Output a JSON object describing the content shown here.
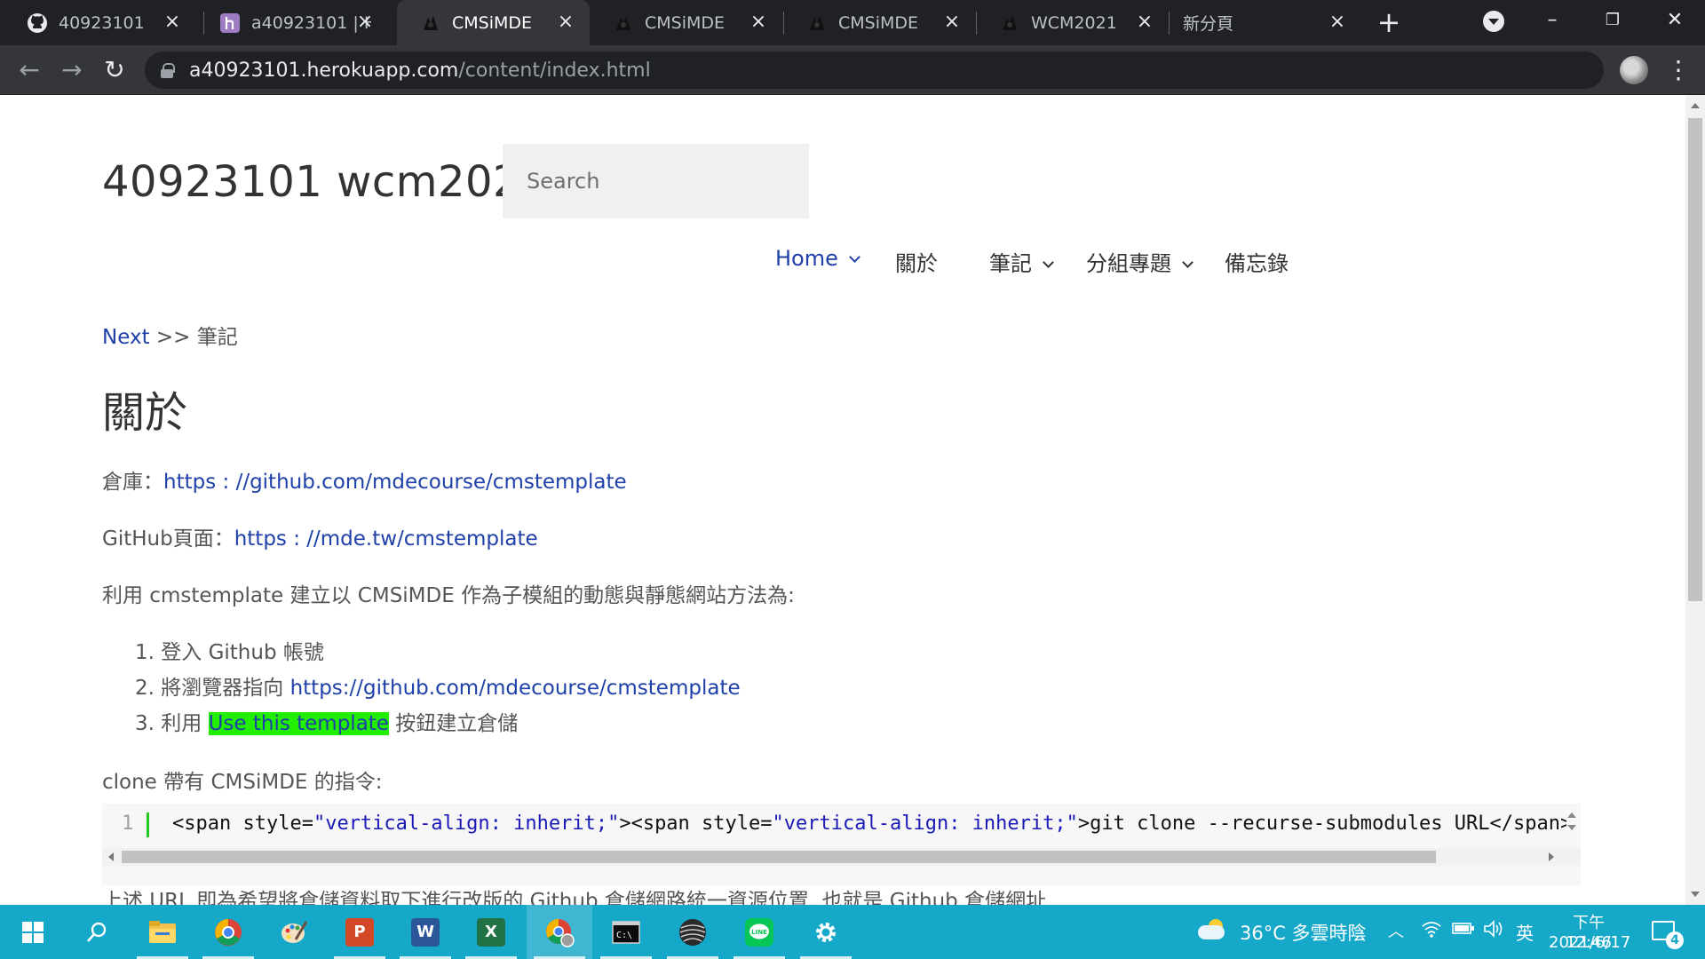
{
  "browser": {
    "tabs": [
      {
        "title": "40923101",
        "favicon": "github-icon",
        "active": false
      },
      {
        "title": "a40923101 | H",
        "favicon": "heroku-icon",
        "active": false
      },
      {
        "title": "CMSiMDE",
        "favicon": "cmsimde-icon",
        "active": true
      },
      {
        "title": "CMSiMDE",
        "favicon": "cmsimde-icon",
        "active": false
      },
      {
        "title": "CMSiMDE",
        "favicon": "cmsimde-icon",
        "active": false
      },
      {
        "title": "WCM2021",
        "favicon": "cmsimde-icon",
        "active": false
      },
      {
        "title": "新分頁",
        "favicon": "",
        "active": false
      }
    ],
    "url_host": "a40923101.herokuapp.com",
    "url_path": "/content/index.html"
  },
  "site": {
    "title": "40923101 wcm2021",
    "search_placeholder": "Search",
    "menu": [
      {
        "label": "Home",
        "has_dropdown": true,
        "current": true
      },
      {
        "label": "關於",
        "has_dropdown": false,
        "current": false
      },
      {
        "label": "筆記",
        "has_dropdown": true,
        "current": false
      },
      {
        "label": "分組專題",
        "has_dropdown": true,
        "current": false
      },
      {
        "label": "備忘錄",
        "has_dropdown": false,
        "current": false
      }
    ]
  },
  "content": {
    "breadcrumb_link": "Next",
    "breadcrumb_rest": " >> 筆記",
    "heading": "關於",
    "repo_label": "倉庫：",
    "repo_link": "https : //github.com/mdecourse/cmstemplate",
    "ghpage_label": "GitHub頁面：",
    "ghpage_link": "https : //mde.tw/cmstemplate",
    "intro": "利用 cmstemplate 建立以 CMSiMDE 作為子模組的動態與靜態網站方法為:",
    "steps": {
      "s1": "1. 登入 Github 帳號",
      "s2_prefix": "2. 將瀏覽器指向 ",
      "s2_link": "https://github.com/mdecourse/cmstemplate",
      "s3_prefix": "3. 利用 ",
      "s3_highlight": "Use this template",
      "s3_suffix": " 按鈕建立倉儲"
    },
    "clone_label": "clone 帶有 CMSiMDE 的指令:",
    "code": {
      "line_number": "1",
      "p1": "<span style=",
      "p2": "\"vertical-align: inherit;\"",
      "p3": "><span style=",
      "p4": "\"vertical-align: inherit;\"",
      "p5": ">git clone --recurse-submodules URL</span></span>"
    },
    "partial_text": "上述 URL 即為希望將倉儲資料取下進行改版的 Github 倉儲網路統一資源位置, 也就是 Github 倉儲網址."
  },
  "taskbar": {
    "apps": [
      "windows-start-icon",
      "search-icon",
      "file-explorer-icon",
      "chrome-icon",
      "paint-icon",
      "powerpoint-icon",
      "word-icon",
      "excel-icon",
      "chrome-profile-icon",
      "terminal-icon",
      "globe-app-icon",
      "line-icon",
      "settings-icon"
    ],
    "weather": "36°C  多雲時陰",
    "ime": "英",
    "time": "下午 12:46",
    "date": "2021/6/17",
    "notifications": "4"
  },
  "colors": {
    "link": "#1e40a8",
    "highlight": "#22ee00",
    "taskbar": "#15a8c8",
    "chrome_dark": "#202124"
  }
}
